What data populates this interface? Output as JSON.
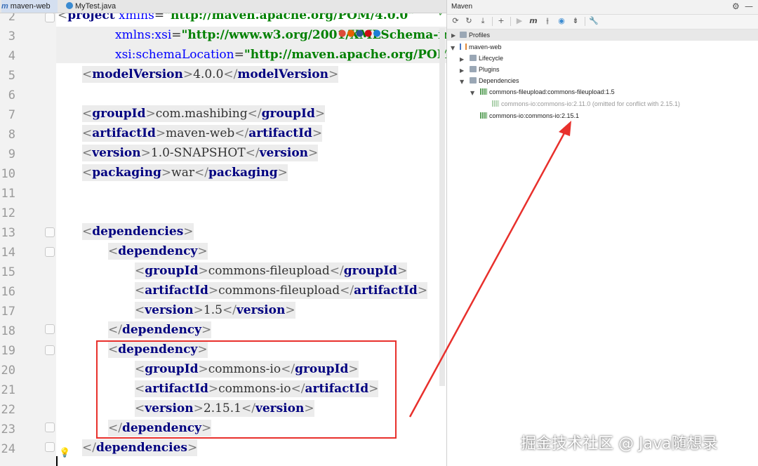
{
  "editor": {
    "tabs": [
      {
        "icon": "m",
        "label": "maven-web"
      },
      {
        "label": "MyTest.java"
      }
    ],
    "line_numbers": [
      "2",
      "3",
      "4",
      "5",
      "6",
      "7",
      "8",
      "9",
      "10",
      "11",
      "12",
      "13",
      "14",
      "15",
      "16",
      "17",
      "18",
      "19",
      "20",
      "21",
      "22",
      "23",
      "24"
    ],
    "lines": {
      "l2": {
        "open": "<",
        "tag": "project",
        "sp": " ",
        "attr": "xmlns",
        "eq": "=",
        "val": "\"http://maven.apache.org/POM/4.0.0\""
      },
      "l3": {
        "attr": "xmlns:xsi",
        "eq": "=",
        "val": "\"http://www.w3.org/2001/XMLSchema-ins"
      },
      "l4": {
        "attr": "xsi:schemaLocation",
        "eq": "=",
        "val": "\"http://maven.apache.org/POM"
      },
      "l5": {
        "o": "<",
        "t": "modelVersion",
        "c": ">",
        "v": "4.0.0",
        "o2": "</",
        "t2": "modelVersion",
        "c2": ">"
      },
      "l7": {
        "o": "<",
        "t": "groupId",
        "c": ">",
        "v": "com.mashibing",
        "o2": "</",
        "t2": "groupId",
        "c2": ">"
      },
      "l8": {
        "o": "<",
        "t": "artifactId",
        "c": ">",
        "v": "maven-web",
        "o2": "</",
        "t2": "artifactId",
        "c2": ">"
      },
      "l9": {
        "o": "<",
        "t": "version",
        "c": ">",
        "v": "1.0-SNAPSHOT",
        "o2": "</",
        "t2": "version",
        "c2": ">"
      },
      "l10": {
        "o": "<",
        "t": "packaging",
        "c": ">",
        "v": "war",
        "o2": "</",
        "t2": "packaging",
        "c2": ">"
      },
      "l13": {
        "o": "<",
        "t": "dependencies",
        "c": ">"
      },
      "l14": {
        "o": "<",
        "t": "dependency",
        "c": ">"
      },
      "l15": {
        "o": "<",
        "t": "groupId",
        "c": ">",
        "v": "commons-fileupload",
        "o2": "</",
        "t2": "groupId",
        "c2": ">"
      },
      "l16": {
        "o": "<",
        "t": "artifactId",
        "c": ">",
        "v": "commons-fileupload",
        "o2": "</",
        "t2": "artifactId",
        "c2": ">"
      },
      "l17": {
        "o": "<",
        "t": "version",
        "c": ">",
        "v": "1.5",
        "o2": "</",
        "t2": "version",
        "c2": ">"
      },
      "l18": {
        "o": "</",
        "t": "dependency",
        "c": ">"
      },
      "l19": {
        "o": "<",
        "t": "dependency",
        "c": ">"
      },
      "l20": {
        "o": "<",
        "t": "groupId",
        "c": ">",
        "v": "commons-io",
        "o2": "</",
        "t2": "groupId",
        "c2": ">"
      },
      "l21": {
        "o": "<",
        "t": "artifactId",
        "c": ">",
        "v": "commons-io",
        "o2": "</",
        "t2": "artifactId",
        "c2": ">"
      },
      "l22": {
        "o": "<",
        "t": "version",
        "c": ">",
        "v": "2.15.1",
        "o2": "</",
        "t2": "version",
        "c2": ">"
      },
      "l23": {
        "o": "</",
        "t": "dependency",
        "c": ">"
      },
      "l24": {
        "o": "</",
        "t": "dependencies",
        "c": ">"
      }
    },
    "checkmark": "✓",
    "lightbulb": "💡"
  },
  "maven": {
    "title": "Maven",
    "gear": "⚙",
    "minimize": "—",
    "toolbar": {
      "reload": "⟳",
      "reimport": "↻",
      "download": "⤓",
      "add": "+",
      "run": "▶",
      "execute": "m",
      "toggle_offline": "⫲",
      "skip_tests": "◉",
      "collapse": "⇟",
      "settings": "🔧"
    },
    "tree": {
      "profiles": "Profiles",
      "project": "maven-web",
      "lifecycle": "Lifecycle",
      "plugins": "Plugins",
      "dependencies": "Dependencies",
      "dep_fileupload": "commons-fileupload:commons-fileupload:1.5",
      "dep_io_omitted": "commons-io:commons-io:2.11.0 (omitted for conflict with 2.15.1)",
      "dep_io": "commons-io:commons-io:2.15.1"
    }
  },
  "watermark": "掘金技术社区 @ Java随想录",
  "colors": {
    "annotation_red": "#e8302c"
  }
}
